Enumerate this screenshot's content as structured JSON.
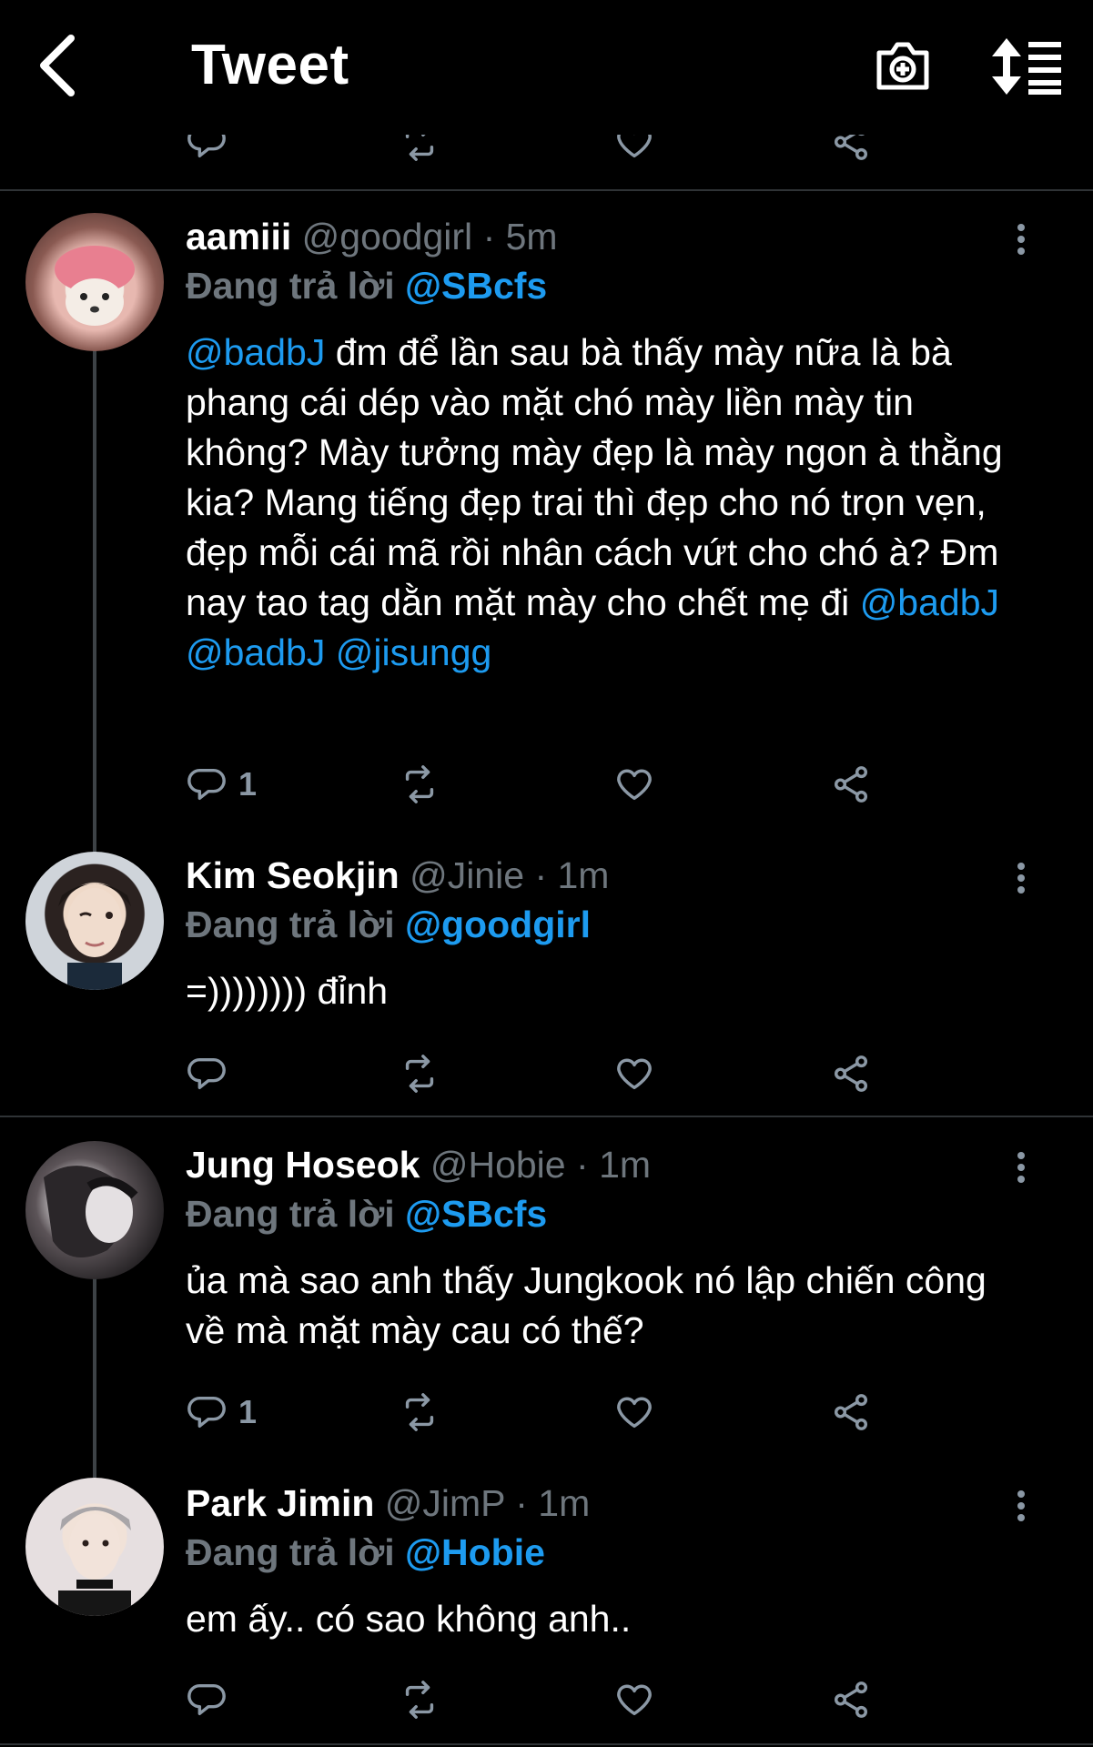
{
  "header": {
    "title": "Tweet",
    "back_icon": "chevron-left-icon",
    "camera_icon": "camera-plus-icon",
    "sort_icon": "sort-list-icon"
  },
  "colors": {
    "background": "#000000",
    "accent": "#1d9bf0",
    "muted": "#6e767d",
    "divider": "#2f3336"
  },
  "tweets": [
    {
      "name": "aamiii",
      "handle": "@goodgirl",
      "dot": "·",
      "time": "5m",
      "reply_prefix": "Đang trả lời",
      "reply_to": "@SBcfs",
      "text_parts": [
        {
          "t": "@badbJ",
          "m": true
        },
        {
          "t": " đm để lần sau bà thấy mày nữa là bà phang cái dép vào mặt chó mày liền mày tin không? Mày tưởng mày đẹp là mày ngon à thằng kia? Mang tiếng đẹp trai thì đẹp cho nó trọn vẹn, đẹp mỗi cái mã rồi nhân cách vứt cho chó à? Đm nay tao tag dằn mặt mày cho chết mẹ đi ",
          "m": false
        },
        {
          "t": "@badbJ",
          "m": true
        },
        {
          "t": " ",
          "m": false
        },
        {
          "t": "@badbJ",
          "m": true
        },
        {
          "t": " ",
          "m": false
        },
        {
          "t": "@jisungg",
          "m": true
        }
      ],
      "reply_count": "1"
    },
    {
      "name": "Kim Seokjin",
      "handle": "@Jinie",
      "dot": "·",
      "time": "1m",
      "reply_prefix": "Đang trả lời",
      "reply_to": "@goodgirl",
      "text_parts": [
        {
          "t": "=)))))))) đỉnh",
          "m": false
        }
      ],
      "reply_count": ""
    },
    {
      "name": "Jung Hoseok",
      "handle": "@Hobie",
      "dot": "·",
      "time": "1m",
      "reply_prefix": "Đang trả lời",
      "reply_to": "@SBcfs",
      "text_parts": [
        {
          "t": "ủa mà sao anh thấy Jungkook nó lập chiến công về mà mặt mày cau có thế?",
          "m": false
        }
      ],
      "reply_count": "1"
    },
    {
      "name": "Park Jimin",
      "handle": "@JimP",
      "dot": "·",
      "time": "1m",
      "reply_prefix": "Đang trả lời",
      "reply_to": "@Hobie",
      "text_parts": [
        {
          "t": "em ấy.. có sao không anh..",
          "m": false
        }
      ],
      "reply_count": ""
    }
  ]
}
